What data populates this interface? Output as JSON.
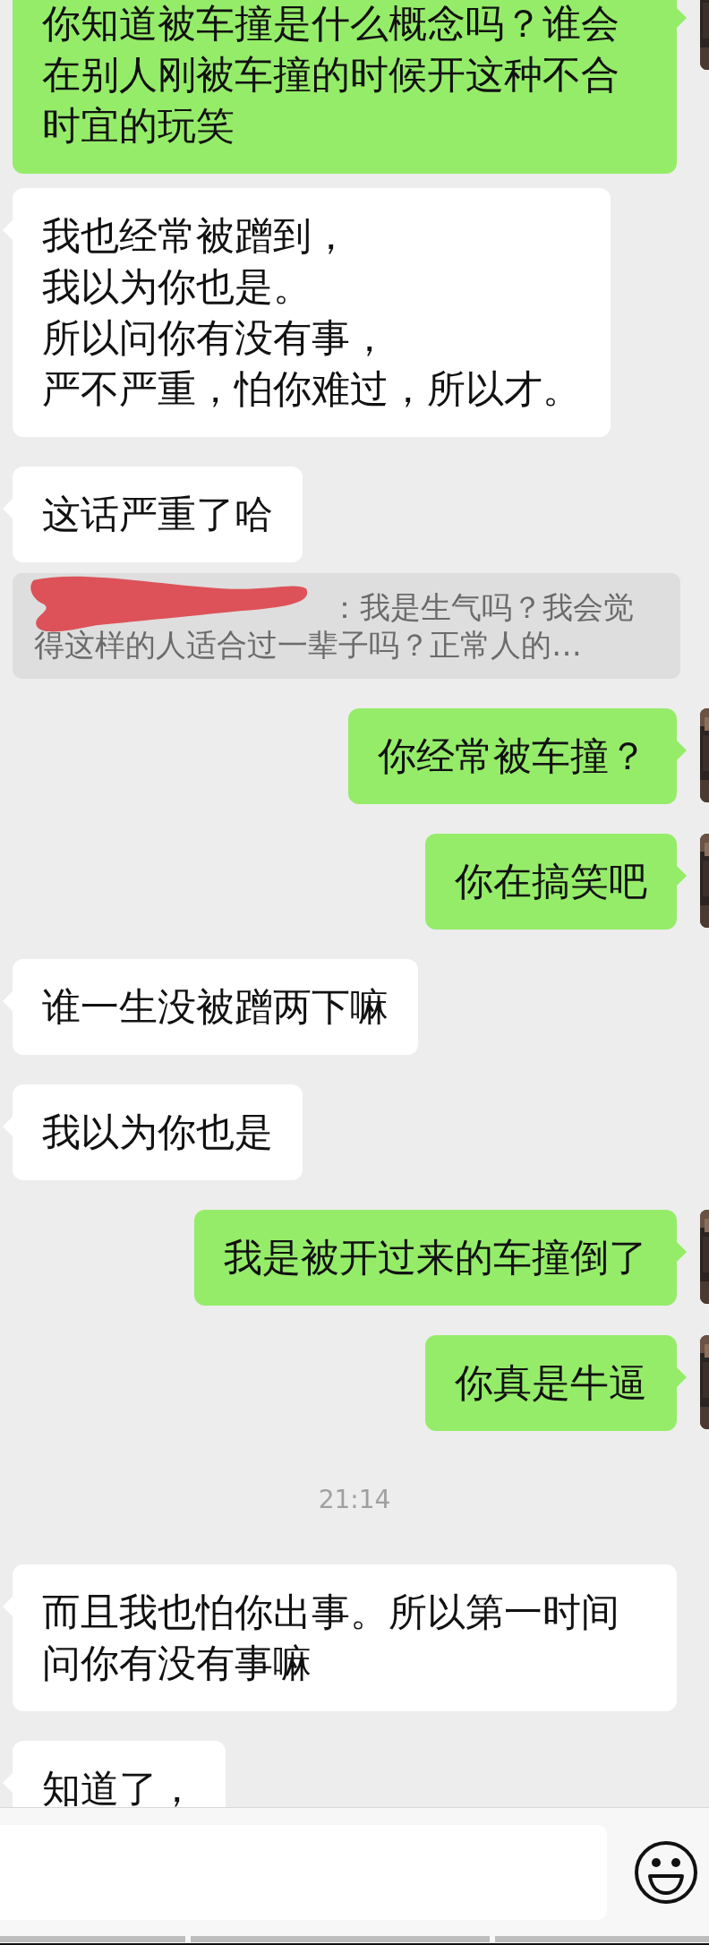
{
  "messages": [
    {
      "kind": "sent",
      "text": "你知道被车撞是什么概念吗？谁会在别人刚被车撞的时候开这种不合时宜的玩笑"
    },
    {
      "kind": "received",
      "lines": [
        "我也经常被蹭到，",
        "我以为你也是。",
        "所以问你有没有事，",
        "严不严重，怕你难过，所以才。"
      ]
    },
    {
      "kind": "received",
      "text": "这话严重了哈"
    },
    {
      "kind": "quote",
      "text": "：我是生气吗？我会觉得这样的人适合过一辈子吗？正常人的…"
    },
    {
      "kind": "sent",
      "text": "你经常被车撞？"
    },
    {
      "kind": "sent",
      "text": "你在搞笑吧"
    },
    {
      "kind": "received",
      "text": "谁一生没被蹭两下嘛"
    },
    {
      "kind": "received",
      "text": "我以为你也是"
    },
    {
      "kind": "sent",
      "text": "我是被开过来的车撞倒了"
    },
    {
      "kind": "sent",
      "text": "你真是牛逼"
    },
    {
      "kind": "time",
      "text": "21:14"
    },
    {
      "kind": "received",
      "text": "而且我也怕你出事。所以第一时间问你有没有事嘛"
    },
    {
      "kind": "received",
      "text": "知道了，"
    }
  ]
}
